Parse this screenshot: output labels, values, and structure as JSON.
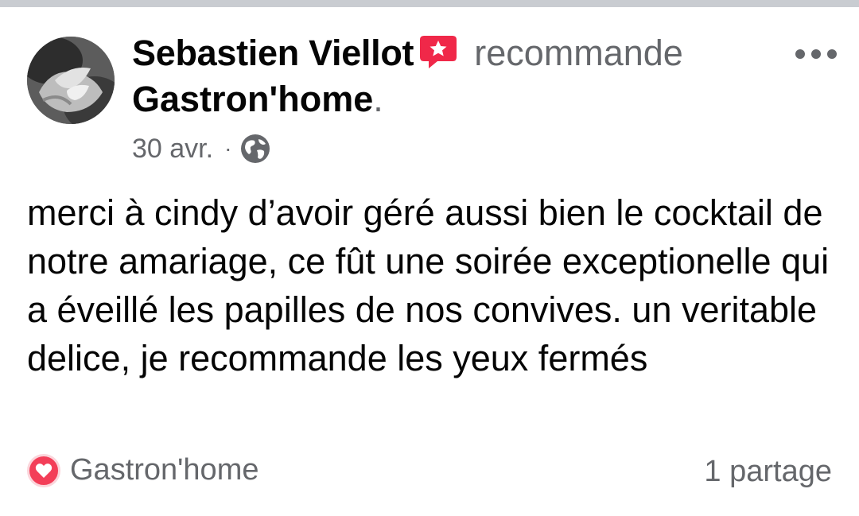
{
  "post": {
    "author": "Sebastien Viellot",
    "verb": "recommande",
    "page": "Gastron'home",
    "page_suffix": ".",
    "date": "30 avr.",
    "separator": "·",
    "visibility_icon": "globe-icon",
    "recommend_icon": "recommendation-star-icon",
    "menu_icon": "more-options-icon",
    "text": "merci à cindy d’avoir géré aussi bien le cocktail de notre amariage, ce fût une soirée exceptionelle qui a éveillé les papilles de nos convives. un veritable delice, je recommande les yeux fermés"
  },
  "footer": {
    "reaction_icon": "love-reaction-icon",
    "reactor": "Gastron'home",
    "shares": "1 partage"
  },
  "colors": {
    "text_primary": "#050505",
    "text_secondary": "#65676b",
    "recommend_red": "#f02849",
    "love_red": "#f33e58"
  }
}
